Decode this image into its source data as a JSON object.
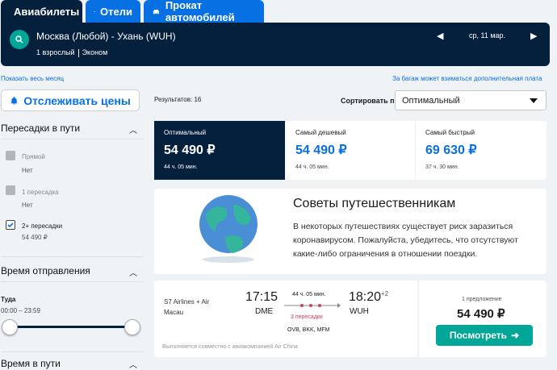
{
  "tabs": [
    {
      "label": "Авиабилеты",
      "active": true
    },
    {
      "label": "Отели",
      "active": false
    },
    {
      "label": "Прокат автомобилей",
      "active": false
    }
  ],
  "search": {
    "route": "Москва (Любой) - Ухань (WUH)",
    "passengers": "1 взрослый",
    "cabin": "Эконом",
    "date": "ср, 11 мар."
  },
  "links": {
    "show_month": "Показать весь месяц",
    "baggage_note": "За багаж может взиматься дополнительная плата"
  },
  "track_prices_label": "Отслеживать цены",
  "filters": {
    "stops": {
      "title": "Пересадки в пути",
      "options": [
        {
          "label": "Прямой",
          "sub": "Нет",
          "checked": false
        },
        {
          "label": "1 пересадка",
          "sub": "Нет",
          "checked": false
        },
        {
          "label": "2+ пересадки",
          "sub": "54 490 ₽",
          "checked": true
        }
      ]
    },
    "departure": {
      "title": "Время отправления",
      "direction": "Туда",
      "range": "00:00 – 23:59"
    },
    "travel_time": {
      "title": "Время в пути"
    }
  },
  "results_count": "Результатов: 16",
  "sort": {
    "label": "Сортировать по",
    "value": "Оптимальный"
  },
  "price_tabs": [
    {
      "label": "Оптимальный",
      "price": "54 490 ₽",
      "duration": "44 ч. 05 мин.",
      "selected": true
    },
    {
      "label": "Самый дешевый",
      "price": "54 490 ₽",
      "duration": "44 ч. 05 мин.",
      "selected": false
    },
    {
      "label": "Самый быстрый",
      "price": "69 630 ₽",
      "duration": "37 ч. 30 мин.",
      "selected": false
    }
  ],
  "tips": {
    "title": "Советы путешественникам",
    "body": "В некоторых путешествиях существует риск заразиться коронавирусом. Пожалуйста, убедитесь, что отсутствуют какие-либо ограничения в отношении поездки."
  },
  "flight": {
    "airline": "S7 Airlines + Air Macau",
    "depart_time": "17:15",
    "depart_airport": "DME",
    "duration": "44 ч. 05 мин.",
    "stops_text": "3 пересадки",
    "stop_airports": "OVB, BKK, MFM",
    "arrive_time": "18:20",
    "day_offset": "+2",
    "arrive_airport": "WUH",
    "operated_by": "Выполняется совместно с авиакомпанией Air China",
    "offers": "1 предложение",
    "price": "54 490 ₽",
    "view_label": "Посмотреть"
  },
  "colors": {
    "navy": "#05203c",
    "blue": "#0770e3",
    "teal": "#00a698",
    "red": "#d1435b"
  }
}
